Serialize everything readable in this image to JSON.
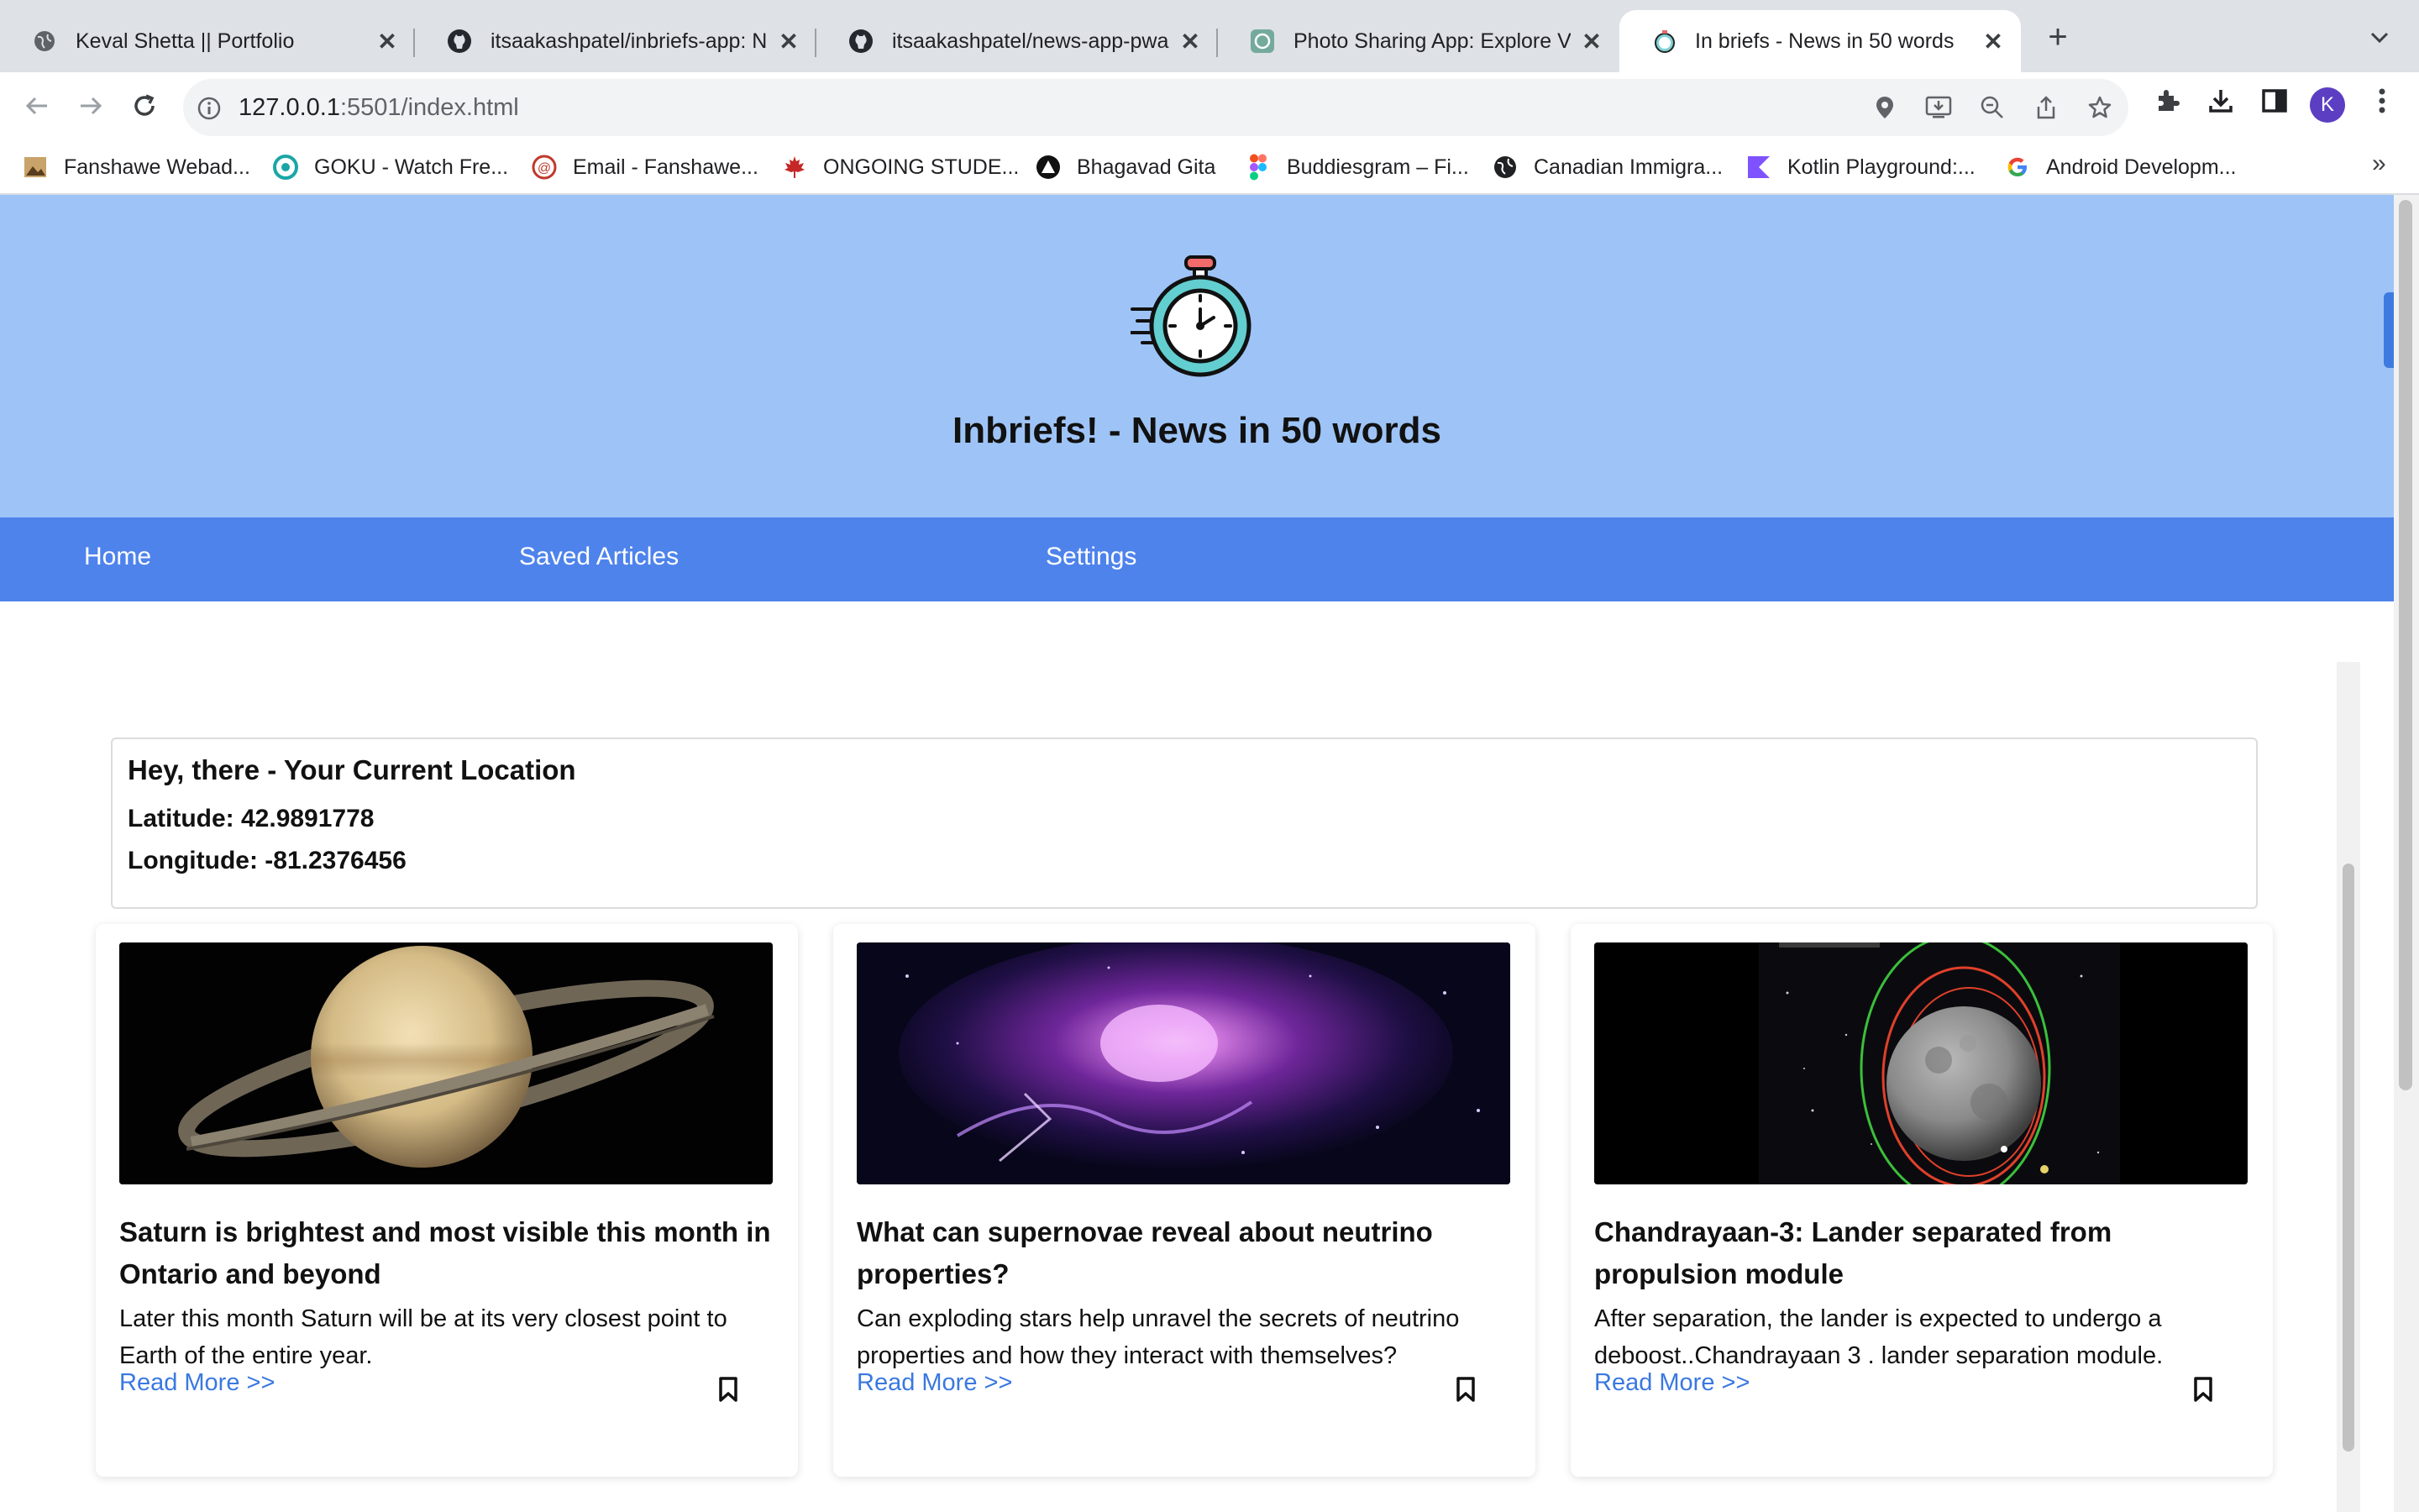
{
  "browser": {
    "tabs": [
      {
        "title": "Keval Shetta || Portfolio",
        "icon": "globe-icon",
        "active": false
      },
      {
        "title": "itsaakashpatel/inbriefs-app: Ne",
        "icon": "github-icon",
        "active": false
      },
      {
        "title": "itsaakashpatel/news-app-pwa:",
        "icon": "github-icon",
        "active": false
      },
      {
        "title": "Photo Sharing App: Explore Vis",
        "icon": "chatgpt-icon",
        "active": false
      },
      {
        "title": "In briefs - News in 50 words",
        "icon": "stopwatch-icon",
        "active": true
      }
    ],
    "close_glyph": "✕",
    "new_tab_glyph": "+",
    "url_host": "127.0.0.1",
    "url_rest": ":5501/index.html",
    "profile_initial": "K",
    "bookmarks": [
      {
        "label": "Fanshawe Webad...",
        "icon": "image-icon"
      },
      {
        "label": "GOKU - Watch Fre...",
        "icon": "circle-logo-icon"
      },
      {
        "label": "Email - Fanshawe...",
        "icon": "mail-icon"
      },
      {
        "label": "ONGOING STUDE...",
        "icon": "maple-leaf-icon"
      },
      {
        "label": "Bhagavad Gita",
        "icon": "triangle-logo-icon"
      },
      {
        "label": "Buddiesgram – Fi...",
        "icon": "figma-icon"
      },
      {
        "label": "Canadian Immigra...",
        "icon": "globe-icon"
      },
      {
        "label": "Kotlin Playground:...",
        "icon": "kotlin-icon"
      },
      {
        "label": "Android Developm...",
        "icon": "google-icon"
      }
    ],
    "bookmarks_more": "»"
  },
  "app": {
    "title": "Inbriefs! - News in 50 words",
    "nav": [
      "Home",
      "Saved Articles",
      "Settings"
    ],
    "location": {
      "heading": "Hey, there - Your Current Location",
      "latitude": "Latitude: 42.9891778",
      "longitude": "Longitude: -81.2376456"
    },
    "articles": [
      {
        "title": "Saturn is brightest and most visible this month in Ontario and beyond",
        "description": "Later this month Saturn will be at its very closest point to Earth of the entire year.",
        "link": "Read More >>",
        "image": "saturn-image"
      },
      {
        "title": "What can supernovae reveal about neutrino properties?",
        "description": "Can exploding stars help unravel the secrets of neutrino properties and how they interact with themselves?",
        "link": "Read More >>",
        "image": "supernova-image"
      },
      {
        "title": "Chandrayaan-3: Lander separated from propulsion module",
        "description": "After separation, the lander is expected to undergo a deboost..Chandrayaan 3 . lander separation module.",
        "link": "Read More >>",
        "image": "moon-orbit-image"
      }
    ]
  },
  "colors": {
    "hero_bg": "#9ec4f7",
    "nav_bg": "#4e83ec",
    "link": "#3a78e0",
    "profile": "#5c3ec2"
  }
}
